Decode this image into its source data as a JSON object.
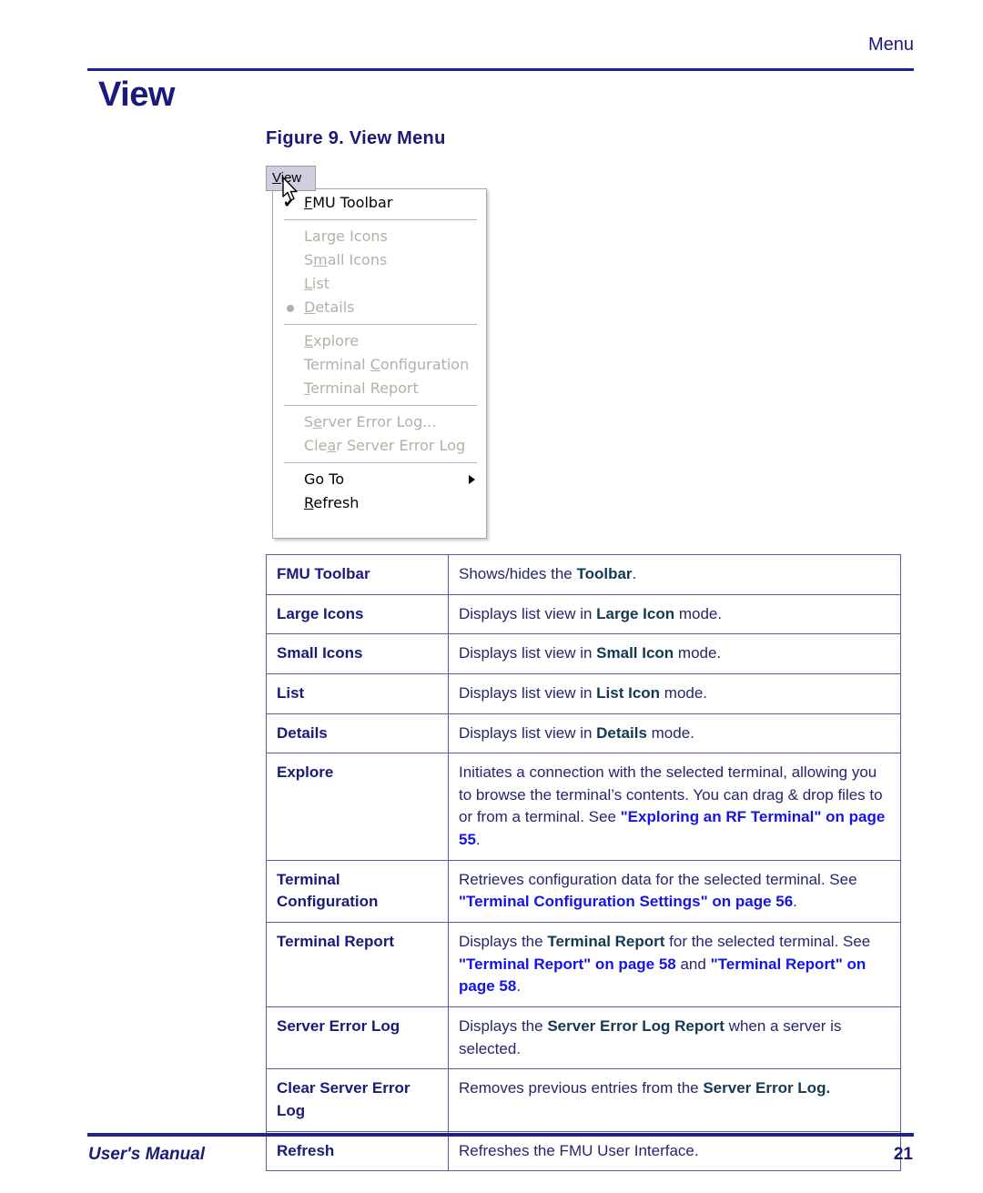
{
  "page": {
    "running_header": "Menu",
    "title": "View",
    "figure_caption": "Figure 9. View Menu",
    "footer_left": "User's Manual",
    "footer_page_number": "21",
    "colors": {
      "navy": "#1a1a7a",
      "rule": "#22228c",
      "table_border": "#5b5b9e",
      "emphasis_dark": "#123a52",
      "link_blue": "#1414e6",
      "menu_disabled": "#b5b0a4",
      "menubar_highlight": "#cfcfe0"
    }
  },
  "figure": {
    "menubar_button": {
      "accel": "V",
      "rest": "iew",
      "full": "View"
    },
    "groups": [
      {
        "items": [
          {
            "marker": "check",
            "check_glyph": "✔",
            "accel": "F",
            "rest": "MU Toolbar",
            "full": "FMU Toolbar",
            "enabled": true
          }
        ]
      },
      {
        "items": [
          {
            "marker": "none",
            "accel": "g",
            "prefix": "Lar",
            "rest": "e Icons",
            "full": "Large Icons",
            "enabled": false
          },
          {
            "marker": "none",
            "accel": "m",
            "prefix": "S",
            "rest": "all Icons",
            "full": "Small Icons",
            "enabled": false
          },
          {
            "marker": "none",
            "accel": "L",
            "prefix": "",
            "rest": "ist",
            "full": "List",
            "enabled": false
          },
          {
            "marker": "radio",
            "accel": "D",
            "prefix": "",
            "rest": "etails",
            "full": "Details",
            "enabled": false
          }
        ]
      },
      {
        "items": [
          {
            "marker": "none",
            "accel": "E",
            "prefix": "",
            "rest": "xplore",
            "full": "Explore",
            "enabled": false
          },
          {
            "marker": "none",
            "accel": "C",
            "prefix": "Terminal ",
            "rest": "onfiguration",
            "full": "Terminal Configuration",
            "enabled": false
          },
          {
            "marker": "none",
            "accel": "T",
            "prefix": "",
            "rest": "erminal Report",
            "full": "Terminal Report",
            "enabled": false
          }
        ]
      },
      {
        "items": [
          {
            "marker": "none",
            "accel": "e",
            "prefix": "S",
            "rest": "rver Error Log...",
            "full": "Server Error Log...",
            "enabled": false
          },
          {
            "marker": "none",
            "accel": "a",
            "prefix": "Cle",
            "rest": "r Server Error Log",
            "full": "Clear Server Error Log",
            "enabled": false
          }
        ]
      },
      {
        "items": [
          {
            "marker": "none",
            "accel": "",
            "prefix": "Go To",
            "rest": "",
            "full": "Go To",
            "enabled": true,
            "submenu": true
          },
          {
            "marker": "none",
            "accel": "R",
            "prefix": "",
            "rest": "efresh",
            "full": "Refresh",
            "enabled": true
          }
        ]
      }
    ]
  },
  "table": {
    "rows": [
      {
        "term": "FMU Toolbar",
        "desc_parts": [
          {
            "text": "Shows/hides the ",
            "style": "plain"
          },
          {
            "text": "Toolbar",
            "style": "dark"
          },
          {
            "text": ".",
            "style": "plain"
          }
        ]
      },
      {
        "term": "Large Icons",
        "desc_parts": [
          {
            "text": "Displays list view in ",
            "style": "plain"
          },
          {
            "text": "Large Icon",
            "style": "dark"
          },
          {
            "text": " mode.",
            "style": "plain"
          }
        ]
      },
      {
        "term": "Small Icons",
        "desc_parts": [
          {
            "text": "Displays list view in ",
            "style": "plain"
          },
          {
            "text": "Small Icon",
            "style": "dark"
          },
          {
            "text": " mode.",
            "style": "plain"
          }
        ]
      },
      {
        "term": "List",
        "desc_parts": [
          {
            "text": "Displays list view in ",
            "style": "plain"
          },
          {
            "text": "List Icon",
            "style": "dark"
          },
          {
            "text": " mode.",
            "style": "plain"
          }
        ]
      },
      {
        "term": "Details",
        "desc_parts": [
          {
            "text": "Displays list view in ",
            "style": "plain"
          },
          {
            "text": "Details",
            "style": "dark"
          },
          {
            "text": " mode.",
            "style": "plain"
          }
        ]
      },
      {
        "term": "Explore",
        "desc_parts": [
          {
            "text": "Initiates a connection with the selected terminal, allowing you to browse the terminal’s contents. You can drag & drop files to or from a terminal. See ",
            "style": "plain"
          },
          {
            "text": "\"Exploring an RF Terminal\" on page 55",
            "style": "link"
          },
          {
            "text": ".",
            "style": "plain"
          }
        ]
      },
      {
        "term": "Terminal Configuration",
        "desc_parts": [
          {
            "text": "Retrieves configuration data for the selected terminal. See ",
            "style": "plain"
          },
          {
            "text": "\"Terminal Configuration Settings\" on page 56",
            "style": "link"
          },
          {
            "text": ".",
            "style": "plain"
          }
        ]
      },
      {
        "term": "Terminal Report",
        "desc_parts": [
          {
            "text": "Displays the ",
            "style": "plain"
          },
          {
            "text": "Terminal Report",
            "style": "dark"
          },
          {
            "text": " for the selected terminal. See ",
            "style": "plain"
          },
          {
            "text": "\"Terminal Report\" on page 58",
            "style": "link"
          },
          {
            "text": " and ",
            "style": "plain"
          },
          {
            "text": "\"Terminal Report\" on page 58",
            "style": "link"
          },
          {
            "text": ".",
            "style": "plain"
          }
        ]
      },
      {
        "term": "Server Error Log",
        "desc_parts": [
          {
            "text": "Displays the ",
            "style": "plain"
          },
          {
            "text": "Server Error Log Report",
            "style": "dark"
          },
          {
            "text": " when a server is selected.",
            "style": "plain"
          }
        ]
      },
      {
        "term": "Clear Server Error Log",
        "desc_parts": [
          {
            "text": "Removes previous entries from the ",
            "style": "plain"
          },
          {
            "text": "Server Error Log.",
            "style": "dark"
          }
        ]
      },
      {
        "term": "Refresh",
        "desc_parts": [
          {
            "text": "Refreshes the FMU User Interface.",
            "style": "plain"
          }
        ]
      }
    ]
  }
}
